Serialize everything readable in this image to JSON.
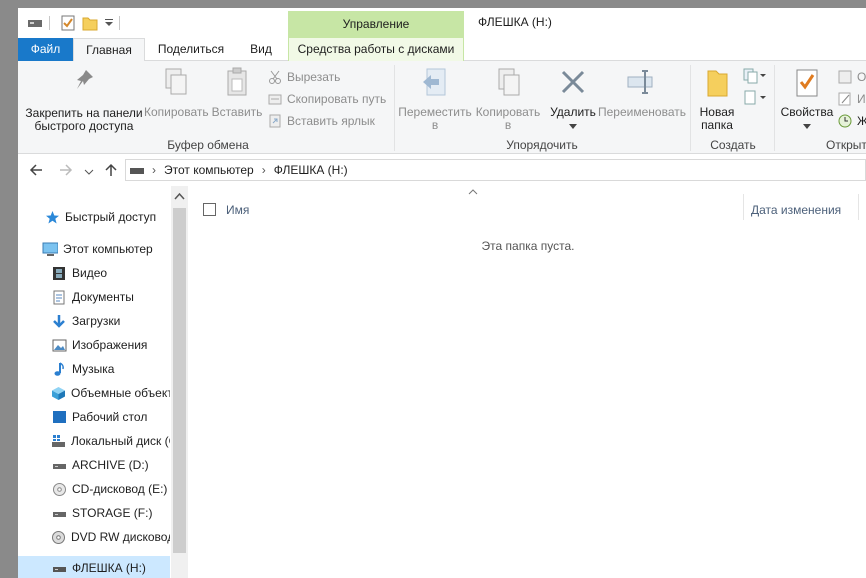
{
  "window": {
    "title": "ФЛЕШКА (H:)",
    "context_tab": "Управление"
  },
  "tabs": [
    "Файл",
    "Главная",
    "Поделиться",
    "Вид",
    "Средства работы с дисками"
  ],
  "ribbon": {
    "pin_label": "Закрепить на панели быстрого доступа",
    "copy_label": "Копировать",
    "paste_label": "Вставить",
    "cut_label": "Вырезать",
    "copy_path_label": "Скопировать путь",
    "paste_shortcut_label": "Вставить ярлык",
    "clipboard_group": "Буфер обмена",
    "move_to_label": "Переместить в",
    "copy_to_label": "Копировать в",
    "delete_label": "Удалить",
    "rename_label": "Переименовать",
    "organize_group": "Упорядочить",
    "new_folder_label": "Новая папка",
    "create_group": "Создать",
    "properties_label": "Свойства",
    "open_group": "Открыть",
    "open_small": "О",
    "edit_small": "И",
    "history_small": "Ж"
  },
  "address": {
    "crumb1": "Этот компьютер",
    "crumb2": "ФЛЕШКА (H:)"
  },
  "sidebar": {
    "items": [
      {
        "label": "Быстрый доступ",
        "icon": "star-icon"
      },
      {
        "label": "Этот компьютер",
        "icon": "computer-icon"
      },
      {
        "label": "Видео",
        "icon": "video-icon"
      },
      {
        "label": "Документы",
        "icon": "documents-icon"
      },
      {
        "label": "Загрузки",
        "icon": "download-icon"
      },
      {
        "label": "Изображения",
        "icon": "pictures-icon"
      },
      {
        "label": "Музыка",
        "icon": "music-icon"
      },
      {
        "label": "Объемные объекты",
        "icon": "cube-icon"
      },
      {
        "label": "Рабочий стол",
        "icon": "desktop-icon"
      },
      {
        "label": "Локальный диск (C:)",
        "icon": "drive-icon"
      },
      {
        "label": "ARCHIVE (D:)",
        "icon": "drive-icon"
      },
      {
        "label": "CD-дисковод (E:)",
        "icon": "cd-icon"
      },
      {
        "label": "STORAGE (F:)",
        "icon": "drive-icon"
      },
      {
        "label": "DVD RW дисковод (G:)",
        "icon": "dvd-icon"
      },
      {
        "label": "ФЛЕШКА (H:)",
        "icon": "usb-drive-icon"
      }
    ]
  },
  "list": {
    "col_name": "Имя",
    "col_date": "Дата изменения",
    "empty": "Эта папка пуста."
  },
  "colors": {
    "file_tab": "#1979ca",
    "context": "#c7e6a5",
    "selection": "#cce8ff"
  }
}
